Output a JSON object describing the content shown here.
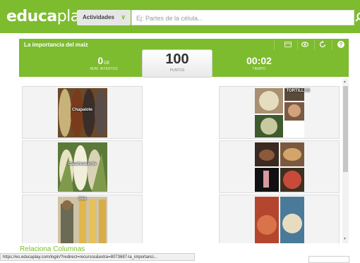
{
  "brand": {
    "logo_part1": "educa",
    "logo_part2": "play",
    "accent": "#7dbb2f"
  },
  "search": {
    "activities_label": "Actividades",
    "placeholder": "Ej: Partes de la célula..."
  },
  "game": {
    "title": "La importancia del maiz",
    "attempts": {
      "value": "0",
      "unit": "DE",
      "label": "NUM. INTENTOS"
    },
    "score": {
      "value": "100",
      "label": "PUNTOS"
    },
    "time": {
      "value": "00:02",
      "label": "TIEMPO"
    },
    "header_icons": [
      "fullscreen-icon",
      "eye-icon",
      "restart-icon",
      "help-icon"
    ]
  },
  "cards": {
    "left": [
      {
        "caption": "Chapalote"
      },
      {
        "caption": "Cacahuacintle"
      },
      {
        "caption": "Jala"
      }
    ],
    "right": [
      {
        "caption": "TORTILLAS"
      },
      {
        "caption": ""
      },
      {
        "caption": ""
      }
    ]
  },
  "partial_heading": "Relaciona Columnas",
  "status_bar": {
    "url": "https://es.educaplay.com/login/?redirect=recursos&extra=8073687-la_importanci..."
  }
}
